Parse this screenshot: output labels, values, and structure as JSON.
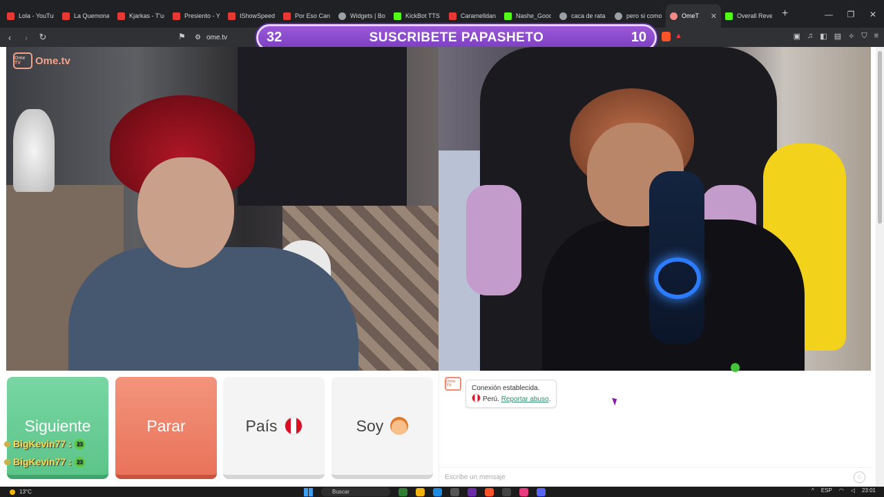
{
  "browser": {
    "tabs": [
      {
        "label": "Lola - YouTub",
        "icon": "youtube-icon"
      },
      {
        "label": "La Quemona",
        "icon": "youtube-icon"
      },
      {
        "label": "Kjarkas - T'un",
        "icon": "youtube-icon"
      },
      {
        "label": "Presiento - Yo",
        "icon": "youtube-icon"
      },
      {
        "label": "IShowSpeed",
        "icon": "youtube-icon"
      },
      {
        "label": "Por Eso Canto",
        "icon": "youtube-icon"
      },
      {
        "label": "Widgets | Bot",
        "icon": "widget-icon"
      },
      {
        "label": "KickBot TTS S",
        "icon": "kickbot-icon"
      },
      {
        "label": "Caramelldans",
        "icon": "youtube-icon"
      },
      {
        "label": "Nashe_Good",
        "icon": "kick-icon"
      },
      {
        "label": "caca de rata",
        "icon": "generic-icon"
      },
      {
        "label": "pero si como",
        "icon": "generic-icon"
      },
      {
        "label": "OmeT",
        "icon": "ometv-icon"
      },
      {
        "label": "Overall Reven",
        "icon": "kick-icon"
      }
    ],
    "url": "ome.tv"
  },
  "overlay": {
    "left_number": "32",
    "title": "SUSCRIBETE PAPASHETO",
    "right_number": "10"
  },
  "site": {
    "logo_text": "Ome.tv",
    "logo_badge": "Ome TV"
  },
  "controls": {
    "next_label": "Siguiente",
    "stop_label": "Parar",
    "country_label": "País",
    "me_label": "Soy"
  },
  "stream_chat": [
    {
      "user": "BigKevin77 :",
      "emote": "23"
    },
    {
      "user": "BigKevin77 :",
      "emote": "23"
    }
  ],
  "chat": {
    "system_icon_text": "Ome TV",
    "connection_text": "Conexión establecida.",
    "country_text": "Perú.",
    "report_link": "Reportar abuso",
    "report_suffix": ".",
    "input_placeholder": "Escribe un mensaje"
  },
  "taskbar": {
    "weather": "13°C",
    "search_placeholder": "Buscar",
    "language": "ESP",
    "time": "23:01"
  },
  "colors": {
    "next": "#5cc489",
    "stop": "#e9735a",
    "overlay": "#8a4acc",
    "report_link": "#2f8c6e"
  }
}
